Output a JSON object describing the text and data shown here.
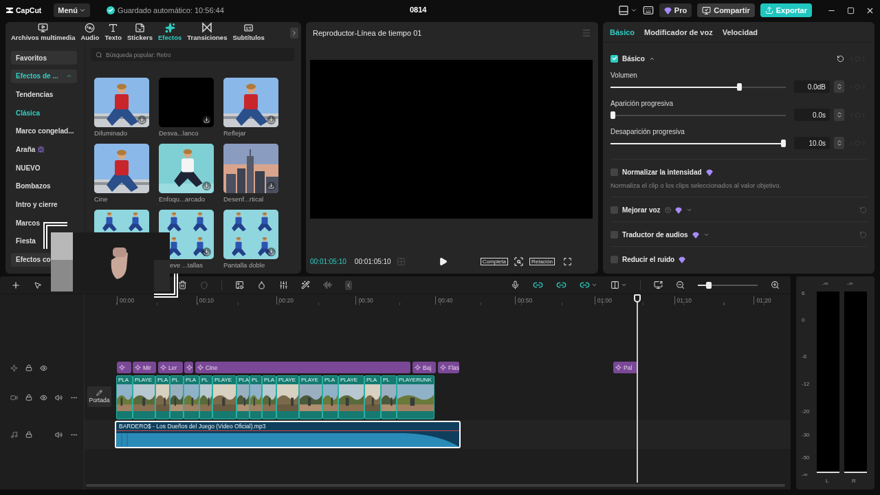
{
  "topbar": {
    "logo": "CapCut",
    "menu": "Menú",
    "autosave": "Guardado automático: 10:56:44",
    "project": "0814",
    "pro": "Pro",
    "share": "Compartir",
    "export": "Exportar"
  },
  "media_tabs": [
    {
      "label": "Archivos multimedia",
      "selected": false
    },
    {
      "label": "Audio",
      "selected": false
    },
    {
      "label": "Texto",
      "selected": false
    },
    {
      "label": "Stickers",
      "selected": false
    },
    {
      "label": "Efectos",
      "selected": true
    },
    {
      "label": "Transiciones",
      "selected": false
    },
    {
      "label": "Subtítulos",
      "selected": false
    }
  ],
  "effects_sidebar": [
    {
      "label": "Favoritos",
      "kind": "box",
      "selected": false
    },
    {
      "label": "Efectos de ...",
      "kind": "group",
      "selected": true,
      "expanded": true
    },
    {
      "label": "Tendencias",
      "kind": "item",
      "selected": false
    },
    {
      "label": "Clásica",
      "kind": "item",
      "selected": true
    },
    {
      "label": "Marco congelad...",
      "kind": "item",
      "selected": false
    },
    {
      "label": "Araña",
      "kind": "item",
      "selected": false,
      "badge": true
    },
    {
      "label": "NUEVO",
      "kind": "item",
      "selected": false
    },
    {
      "label": "Bombazos",
      "kind": "item",
      "selected": false
    },
    {
      "label": "Intro y cierre",
      "kind": "item",
      "selected": false
    },
    {
      "label": "Marcos",
      "kind": "item",
      "selected": false
    },
    {
      "label": "Fiesta",
      "kind": "item",
      "selected": false
    },
    {
      "label": "Efectos co",
      "kind": "box",
      "selected": false
    }
  ],
  "search": {
    "placeholder": "Búsqueda popular: Retro"
  },
  "effects": [
    {
      "label": "Difuminado",
      "download": true
    },
    {
      "label": "Desva...lanco",
      "download": true
    },
    {
      "label": "Reflejar",
      "download": true
    },
    {
      "label": "Cine",
      "download": false
    },
    {
      "label": "Enfoqu...arcado",
      "download": true
    },
    {
      "label": "Desenf...rtical",
      "download": true
    },
    {
      "download": false
    },
    {
      "label": "eve ...tallas",
      "download": true
    },
    {
      "label": "Pantalla doble",
      "download": true
    }
  ],
  "player": {
    "title": "Reproductor-Línea de tiempo 01",
    "current": "00:01:05:10",
    "total": "00:01:05:10",
    "fit": "Completa",
    "ratio": "Relación"
  },
  "inspector": {
    "tabs": [
      {
        "label": "Básico",
        "selected": true
      },
      {
        "label": "Modificador de voz",
        "selected": false
      },
      {
        "label": "Velocidad",
        "selected": false
      }
    ],
    "section": {
      "label": "Básico",
      "checked": true,
      "expanded": true
    },
    "sliders": [
      {
        "label": "Volumen",
        "level": 0.74,
        "value": "0.0dB"
      },
      {
        "label": "Aparición progresiva",
        "level": 0,
        "value": "0.0s"
      },
      {
        "label": "Desaparición progresiva",
        "level": 1,
        "value": "10.0s"
      }
    ],
    "options": [
      {
        "label": "Normalizar la intensidad",
        "checked": false,
        "help": false,
        "dropdown": false,
        "reset": false,
        "description": "Normaliza el clip o los clips seleccionados al valor objetivo."
      },
      {
        "label": "Mejorar voz",
        "checked": false,
        "help": true,
        "dropdown": true,
        "reset": true
      },
      {
        "label": "Traductor de audios",
        "checked": false,
        "help": false,
        "dropdown": true,
        "reset": true
      },
      {
        "label": "Reducir el ruido",
        "checked": false,
        "help": false,
        "dropdown": false,
        "reset": false
      }
    ]
  },
  "timeline": {
    "ruler": [
      "00:00",
      "00:10",
      "00:20",
      "00:30",
      "00:40",
      "00:50",
      "01:00",
      "01:10",
      "01:20"
    ],
    "zoom": {
      "level": 0.18
    },
    "cover": "Portada",
    "effect_clips": [
      {
        "kind": "icon"
      },
      {
        "kind": "labeled",
        "label": "Mir"
      },
      {
        "kind": "labeled",
        "label": "Ler"
      },
      {
        "kind": "icon"
      },
      {
        "kind": "labeled",
        "label": "Cine"
      },
      {
        "kind": "labeled",
        "label": "Baj"
      },
      {
        "kind": "labeled",
        "label": "Flas"
      },
      {
        "kind": "labeled",
        "label": "Pal"
      }
    ],
    "video_clips": [
      "PLA",
      "PLAYE",
      "PLA",
      "PL",
      "PLA",
      "PL",
      "PLAYE",
      "PLA",
      "PL",
      "PLA",
      "PLAYE",
      "PLAYE",
      "PLA",
      "PLAYE",
      "PLA",
      "PL",
      "PLAYERUNK"
    ],
    "audio_clip": {
      "title": "BARDERO$ - Los Dueños del Juego (Video Oficial).mp3",
      "selected": true
    }
  },
  "meter": {
    "peaks": [
      "-∞",
      "-∞"
    ],
    "scale": [
      "6",
      "0",
      "-6",
      "-12",
      "-20",
      "-30",
      "-50",
      "-∞"
    ],
    "channels": [
      "L",
      "R"
    ]
  }
}
